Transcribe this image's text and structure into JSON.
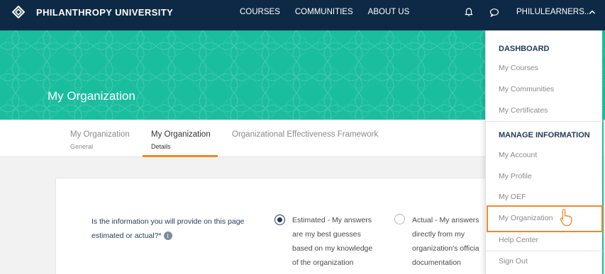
{
  "nav": {
    "brand": "PHILANTHROPY UNIVERSITY",
    "links": [
      "COURSES",
      "COMMUNITIES",
      "ABOUT US"
    ],
    "user": "PHILULEARNERS...",
    "icons": [
      "logo-icon",
      "bell-icon",
      "chat-icon",
      "chevron-up-icon"
    ]
  },
  "banner": {
    "title": "My Organization",
    "color": "#1bbd9f"
  },
  "tabs": [
    {
      "label": "My Organization",
      "sub": "General"
    },
    {
      "label": "My Organization",
      "sub": "Details"
    },
    {
      "label": "Organizational Effectiveness Framework",
      "sub": ""
    }
  ],
  "active_tab": 1,
  "form": {
    "question": "Is the information you will provide on this page estimated or actual?*",
    "options": [
      {
        "lines": [
          "Estimated - My answers",
          "are my best guesses",
          "based on my knowledge",
          "of the organization"
        ],
        "selected": true
      },
      {
        "lines": [
          "Actual - My answers",
          "directly from my",
          "organization's officia",
          "documentation"
        ],
        "selected": false
      }
    ]
  },
  "dropdown": {
    "section1": "DASHBOARD",
    "items1": [
      "My Courses",
      "My Communities",
      "My Certificates"
    ],
    "section2": "MANAGE INFORMATION",
    "items2": [
      "My Account",
      "My Profile",
      "My OEF",
      "My Organization",
      "Help Center",
      "Sign Out"
    ],
    "highlighted": "My Organization"
  },
  "colors": {
    "navbar": "#0d2945",
    "accent": "#f08a24",
    "teal": "#1bbd9f",
    "navy_text": "#1f3a5a"
  }
}
